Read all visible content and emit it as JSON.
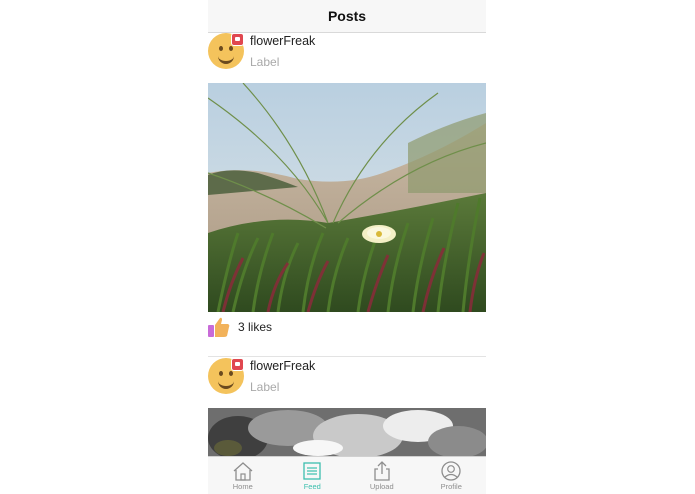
{
  "navbar": {
    "title": "Posts"
  },
  "posts": [
    {
      "username": "flowerFreak",
      "label": "Label",
      "likes": "3 likes"
    },
    {
      "username": "flowerFreak",
      "label": "Label"
    }
  ],
  "tabbar": {
    "items": [
      {
        "label": "Home",
        "icon": "home-icon",
        "active": false
      },
      {
        "label": "Feed",
        "icon": "feed-icon",
        "active": true
      },
      {
        "label": "Upload",
        "icon": "upload-icon",
        "active": false
      },
      {
        "label": "Profile",
        "icon": "profile-icon",
        "active": false
      }
    ]
  },
  "colors": {
    "accent": "#3cbfae",
    "inactive": "#8e8e8e",
    "badge": "#e0474f",
    "avatar": "#f4c35c"
  }
}
